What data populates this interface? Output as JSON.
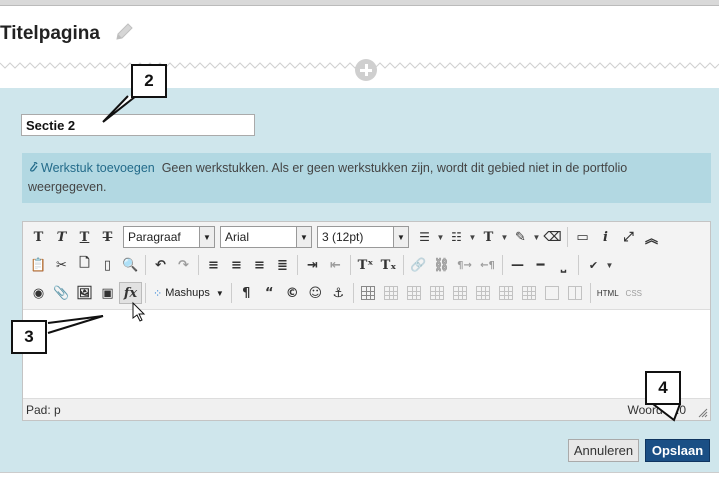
{
  "page": {
    "title": "Titelpagina",
    "edit_icon": "pencil-icon",
    "add_icon": "plus-circle-icon"
  },
  "section": {
    "title_value": "Sectie 2"
  },
  "attachments": {
    "link_label": "Werkstuk toevoegen",
    "message": "Geen werkstukken. Als er geen werkstukken zijn, wordt dit gebied niet in de portfolio weergegeven."
  },
  "editor": {
    "format_select": "Paragraaf",
    "font_select": "Arial",
    "size_select": "3 (12pt)",
    "mashups_label": "Mashups",
    "html_label": "HTML",
    "css_label": "CSS",
    "path_label": "Pad: p",
    "word_count_label": "Woorden:0"
  },
  "buttons": {
    "cancel": "Annuleren",
    "save": "Opslaan"
  },
  "callouts": {
    "c2": "2",
    "c3": "3",
    "c4": "4"
  },
  "colors": {
    "panel_bg": "#cfe6ec",
    "attach_bg": "#b2d8e2",
    "save_bg": "#1a4f85",
    "link": "#236b8a"
  }
}
